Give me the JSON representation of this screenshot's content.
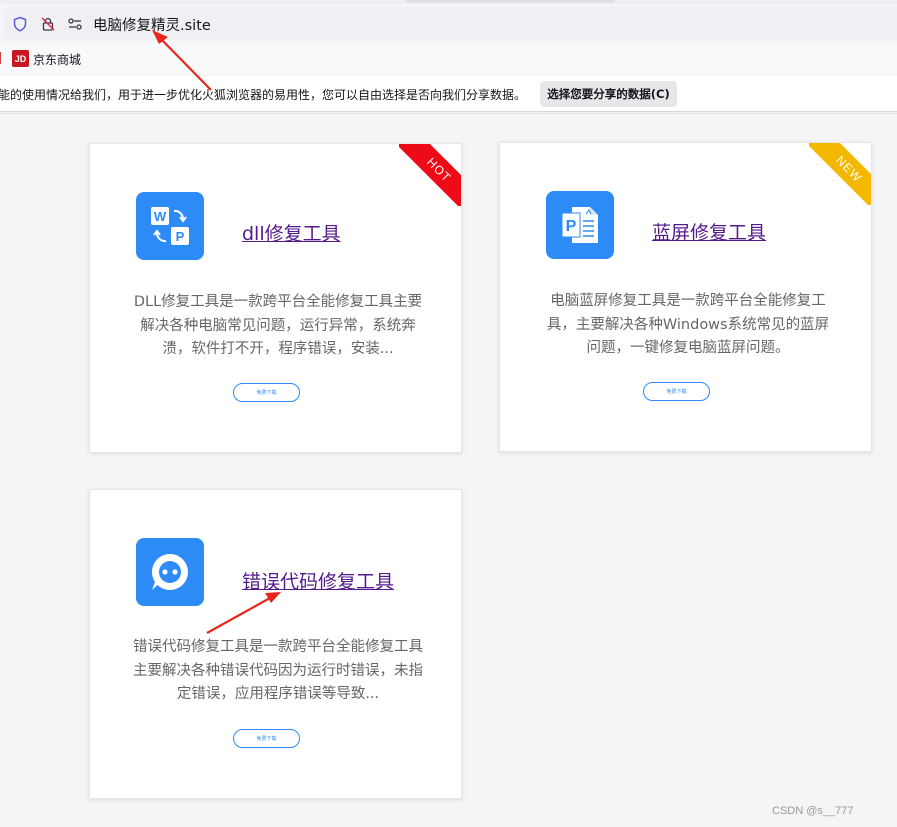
{
  "browser": {
    "url": "电脑修复精灵.site",
    "bookmark": {
      "label": "京东商城",
      "logo_text": "JD"
    },
    "notice": {
      "text": "能的使用情况给我们，用于进一步优化火狐浏览器的易用性，您可以自由选择是否向我们分享数据。",
      "button": "选择您要分享的数据(C)"
    }
  },
  "cards": [
    {
      "title": "dll修复工具",
      "description": "DLL修复工具是一款跨平台全能修复工具主要解决各种电脑常见问题，运行异常，系统奔溃，软件打不开，程序错误，安装...",
      "button": "免费下载",
      "badge": "HOT",
      "icon": "word-to-pdf-icon"
    },
    {
      "title": "蓝屏修复工具",
      "description": "电脑蓝屏修复工具是一款跨平台全能修复工具，主要解决各种Windows系统常见的蓝屏问题，一键修复电脑蓝屏问题。",
      "button": "免费下载",
      "badge": "NEW",
      "icon": "document-file-icon"
    },
    {
      "title": "错误代码修复工具",
      "description": "错误代码修复工具是一款跨平台全能修复工具主要解决各种错误代码因为运行时错误，未指定错误，应用程序错误等导致...",
      "button": "免费下载",
      "icon": "chat-bot-icon"
    }
  ],
  "watermark": "CSDN @s__777",
  "colors": {
    "accent": "#2c8bf6",
    "hot": "#ee0b18",
    "new": "#f5b800",
    "annotation": "#e8261a"
  }
}
